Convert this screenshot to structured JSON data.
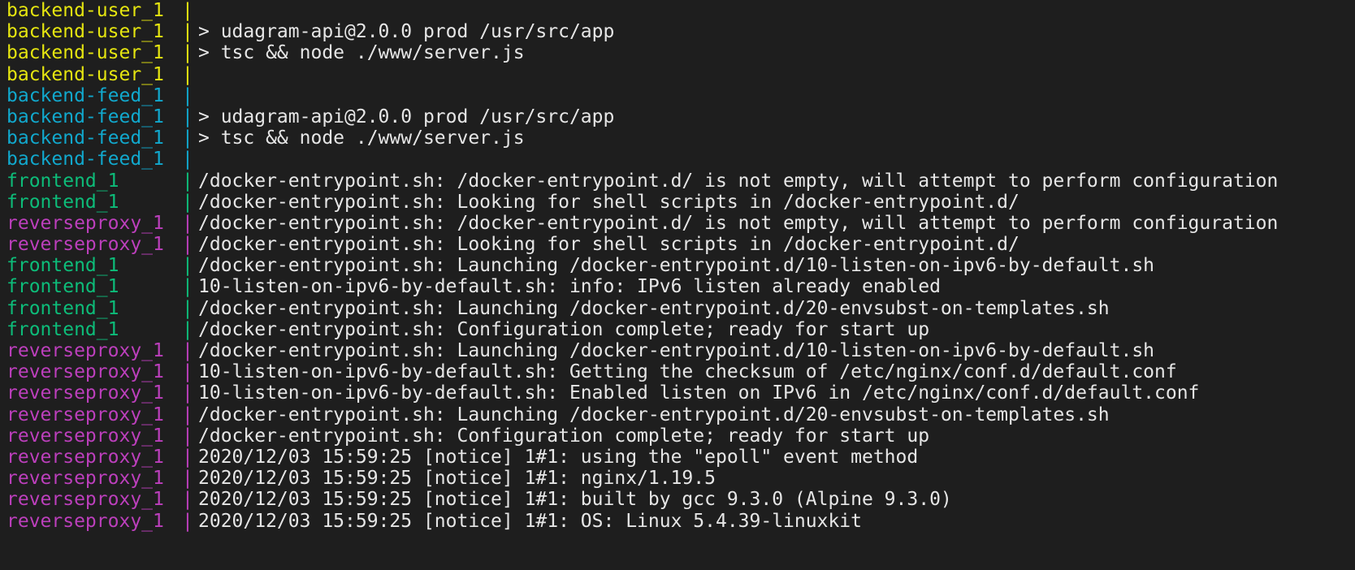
{
  "colors": {
    "background": "#1e1e1e",
    "message": "#e6e6e6",
    "backend-user": "#e5e510",
    "backend-feed": "#11a8cd",
    "frontend": "#0dbc79",
    "reverseproxy": "#bc3fbc"
  },
  "terminal": {
    "separator": "|",
    "lines": [
      {
        "service": "backend-user_1",
        "kind": "backend-user",
        "message": ""
      },
      {
        "service": "backend-user_1",
        "kind": "backend-user",
        "message": "> udagram-api@2.0.0 prod /usr/src/app"
      },
      {
        "service": "backend-user_1",
        "kind": "backend-user",
        "message": "> tsc && node ./www/server.js"
      },
      {
        "service": "backend-user_1",
        "kind": "backend-user",
        "message": ""
      },
      {
        "service": "backend-feed_1",
        "kind": "backend-feed",
        "message": ""
      },
      {
        "service": "backend-feed_1",
        "kind": "backend-feed",
        "message": "> udagram-api@2.0.0 prod /usr/src/app"
      },
      {
        "service": "backend-feed_1",
        "kind": "backend-feed",
        "message": "> tsc && node ./www/server.js"
      },
      {
        "service": "backend-feed_1",
        "kind": "backend-feed",
        "message": ""
      },
      {
        "service": "frontend_1",
        "kind": "frontend",
        "message": "/docker-entrypoint.sh: /docker-entrypoint.d/ is not empty, will attempt to perform configuration"
      },
      {
        "service": "frontend_1",
        "kind": "frontend",
        "message": "/docker-entrypoint.sh: Looking for shell scripts in /docker-entrypoint.d/"
      },
      {
        "service": "reverseproxy_1",
        "kind": "reverseproxy",
        "message": "/docker-entrypoint.sh: /docker-entrypoint.d/ is not empty, will attempt to perform configuration"
      },
      {
        "service": "reverseproxy_1",
        "kind": "reverseproxy",
        "message": "/docker-entrypoint.sh: Looking for shell scripts in /docker-entrypoint.d/"
      },
      {
        "service": "frontend_1",
        "kind": "frontend",
        "message": "/docker-entrypoint.sh: Launching /docker-entrypoint.d/10-listen-on-ipv6-by-default.sh"
      },
      {
        "service": "frontend_1",
        "kind": "frontend",
        "message": "10-listen-on-ipv6-by-default.sh: info: IPv6 listen already enabled"
      },
      {
        "service": "frontend_1",
        "kind": "frontend",
        "message": "/docker-entrypoint.sh: Launching /docker-entrypoint.d/20-envsubst-on-templates.sh"
      },
      {
        "service": "frontend_1",
        "kind": "frontend",
        "message": "/docker-entrypoint.sh: Configuration complete; ready for start up"
      },
      {
        "service": "reverseproxy_1",
        "kind": "reverseproxy",
        "message": "/docker-entrypoint.sh: Launching /docker-entrypoint.d/10-listen-on-ipv6-by-default.sh"
      },
      {
        "service": "reverseproxy_1",
        "kind": "reverseproxy",
        "message": "10-listen-on-ipv6-by-default.sh: Getting the checksum of /etc/nginx/conf.d/default.conf"
      },
      {
        "service": "reverseproxy_1",
        "kind": "reverseproxy",
        "message": "10-listen-on-ipv6-by-default.sh: Enabled listen on IPv6 in /etc/nginx/conf.d/default.conf"
      },
      {
        "service": "reverseproxy_1",
        "kind": "reverseproxy",
        "message": "/docker-entrypoint.sh: Launching /docker-entrypoint.d/20-envsubst-on-templates.sh"
      },
      {
        "service": "reverseproxy_1",
        "kind": "reverseproxy",
        "message": "/docker-entrypoint.sh: Configuration complete; ready for start up"
      },
      {
        "service": "reverseproxy_1",
        "kind": "reverseproxy",
        "message": "2020/12/03 15:59:25 [notice] 1#1: using the \"epoll\" event method"
      },
      {
        "service": "reverseproxy_1",
        "kind": "reverseproxy",
        "message": "2020/12/03 15:59:25 [notice] 1#1: nginx/1.19.5"
      },
      {
        "service": "reverseproxy_1",
        "kind": "reverseproxy",
        "message": "2020/12/03 15:59:25 [notice] 1#1: built by gcc 9.3.0 (Alpine 9.3.0)"
      },
      {
        "service": "reverseproxy_1",
        "kind": "reverseproxy",
        "message": "2020/12/03 15:59:25 [notice] 1#1: OS: Linux 5.4.39-linuxkit"
      }
    ]
  }
}
